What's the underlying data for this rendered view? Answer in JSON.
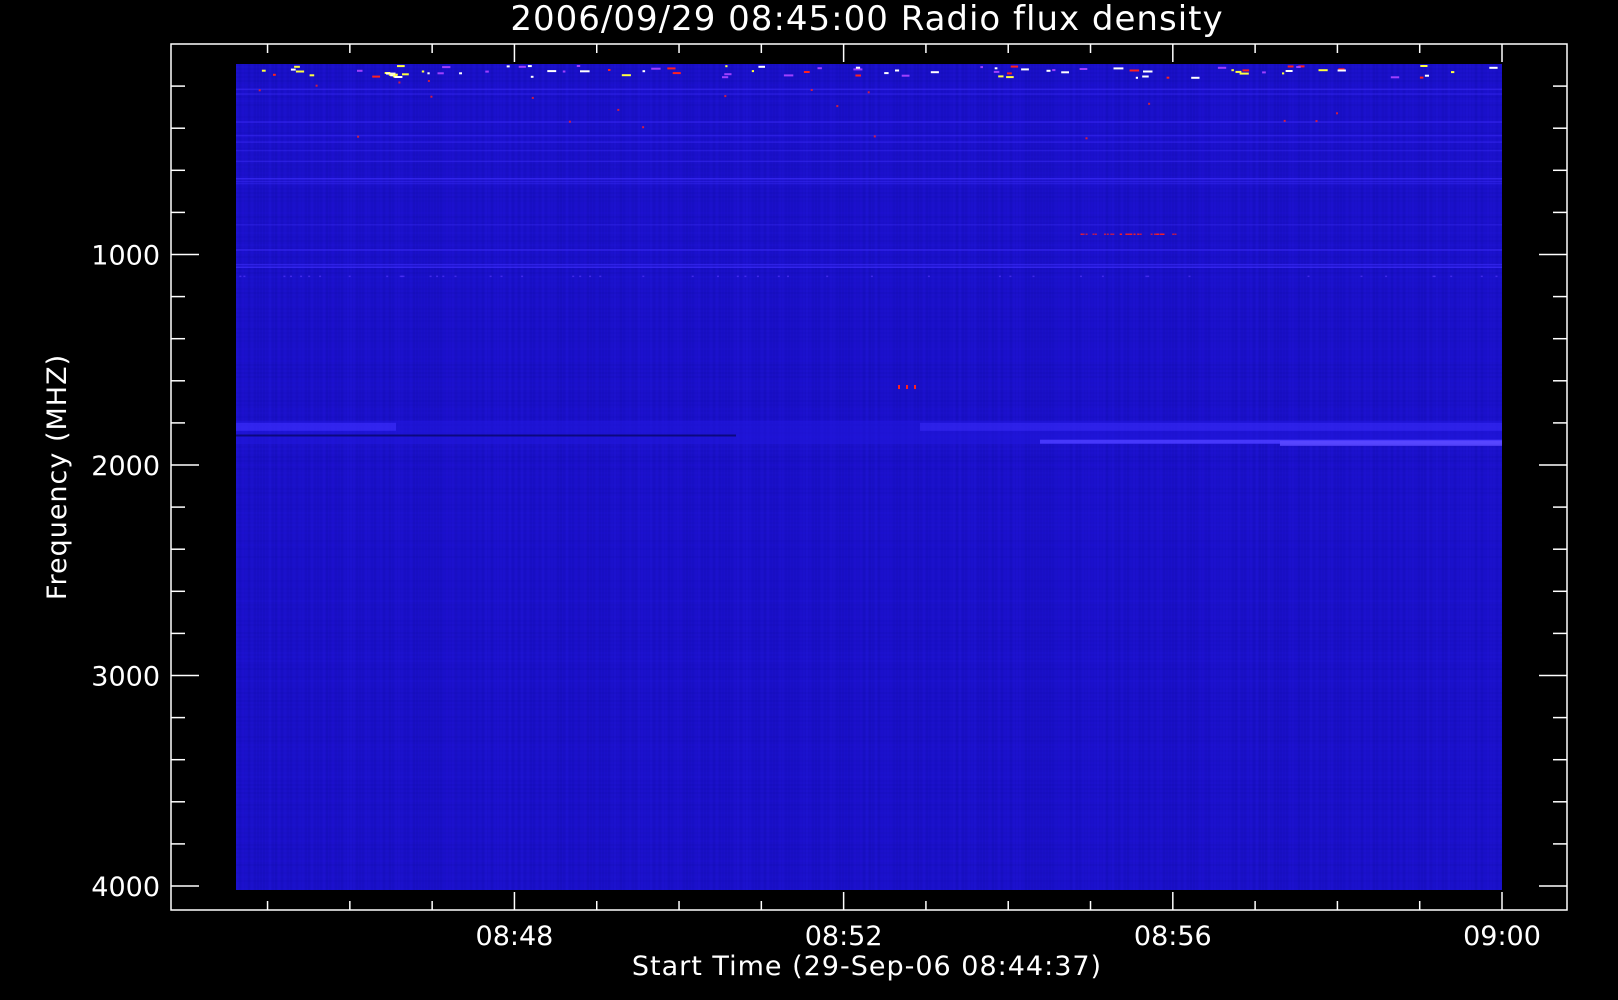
{
  "chart_data": {
    "type": "heatmap",
    "title": "2006/09/29 08:45:00 Radio flux density",
    "xlabel": "Start Time (29-Sep-06 08:44:37)",
    "ylabel": "Frequency (MHZ)",
    "x_start": "08:44:37",
    "x_end": "09:00:00",
    "x_axis_range_minutes": [
      0,
      16
    ],
    "x_ticks": [
      {
        "label": "08:48"
      },
      {
        "label": "08:52"
      },
      {
        "label": "08:56"
      },
      {
        "label": "09:00"
      }
    ],
    "y_axis_range_mhz": [
      4000,
      0
    ],
    "y_ticks": [
      {
        "label": "1000",
        "value": 1000
      },
      {
        "label": "2000",
        "value": 2000
      },
      {
        "label": "3000",
        "value": 3000
      },
      {
        "label": "4000",
        "value": 4000
      }
    ],
    "data_frequency_range_mhz": [
      900,
      4000
    ],
    "colormap": {
      "background": "#000000",
      "low": "#1a10c8",
      "mid": "#2218e0",
      "elevated": "#4030ff",
      "high": "#ff2020",
      "peak": "#ffff40"
    },
    "features": {
      "interference_band_top_mhz": [
        900,
        1060
      ],
      "enhanced_band_mhz": [
        1790,
        1900
      ]
    }
  }
}
